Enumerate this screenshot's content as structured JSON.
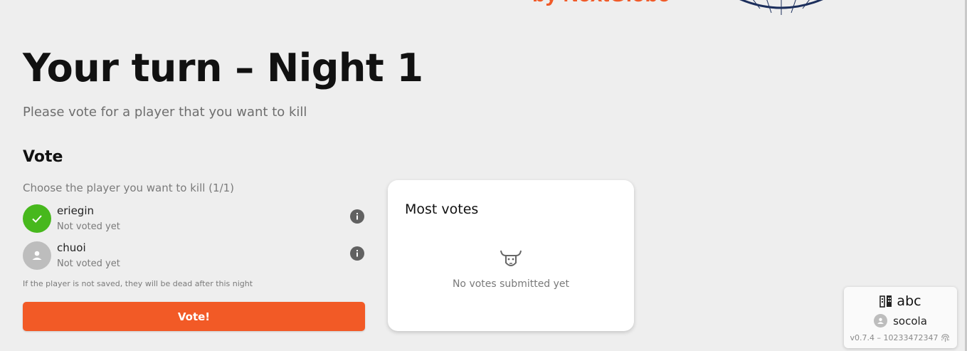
{
  "brand": {
    "text": "by NextGlobe"
  },
  "header": {
    "title": "Your turn – Night 1",
    "subtitle": "Please vote for a player that you want to kill"
  },
  "vote": {
    "section_title": "Vote",
    "instruction": "Choose the player you want to kill (1/1)",
    "players": [
      {
        "name": "eriegin",
        "status": "Not voted yet",
        "selected": true,
        "avatar_icon": "check-icon"
      },
      {
        "name": "chuoi",
        "status": "Not voted yet",
        "selected": false,
        "avatar_icon": "person-icon"
      }
    ],
    "note": "If the player is not saved, they will be dead after this night",
    "button_label": "Vote!"
  },
  "most_votes": {
    "title": "Most votes",
    "empty_icon": "bull-skull-icon",
    "empty_text": "No votes submitted yet"
  },
  "room_widget": {
    "room_icon": "building-icon",
    "room_name": "abc",
    "user_icon": "person-icon",
    "user_name": "socola",
    "version": "v0.7.4 – 10233472347",
    "fingerprint_icon": "fingerprint-icon"
  },
  "colors": {
    "accent": "#f25a26",
    "selected": "#47b81d",
    "background": "#eeeeee",
    "logo_navy": "#1c2f5c"
  }
}
